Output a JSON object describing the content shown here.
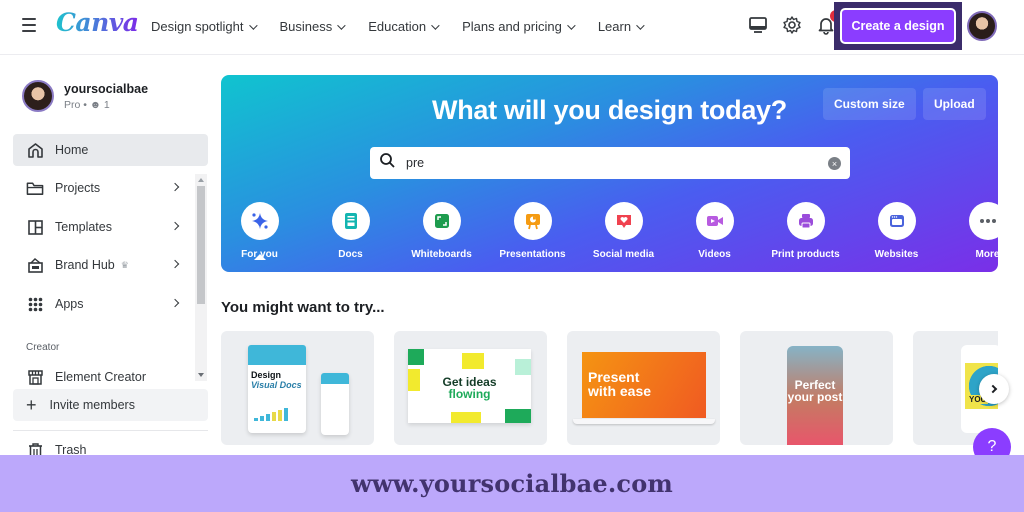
{
  "topbar": {
    "logo": "Canva",
    "nav": [
      {
        "label": "Design spotlight"
      },
      {
        "label": "Business"
      },
      {
        "label": "Education"
      },
      {
        "label": "Plans and pricing"
      },
      {
        "label": "Learn"
      }
    ],
    "icons": [
      "desktop-icon",
      "gear-icon",
      "bell-icon"
    ],
    "notification_count": "1",
    "create_label": "Create a design"
  },
  "sidebar": {
    "user_name": "yoursocialbae",
    "user_plan": "Pro",
    "user_members": "1",
    "items": [
      {
        "label": "Home",
        "icon": "home-icon",
        "active": true
      },
      {
        "label": "Projects",
        "icon": "folder-icon"
      },
      {
        "label": "Templates",
        "icon": "templates-icon"
      },
      {
        "label": "Brand Hub",
        "icon": "brand-icon"
      },
      {
        "label": "Apps",
        "icon": "apps-icon"
      }
    ],
    "heading": "Creator",
    "creator_item": "Element Creator",
    "invite_label": "Invite members",
    "trash_label": "Trash"
  },
  "hero": {
    "title": "What will you design today?",
    "custom_size": "Custom size",
    "upload": "Upload",
    "search_value": "pre",
    "categories": [
      {
        "label": "For you",
        "color": "#3a63e8"
      },
      {
        "label": "Docs",
        "color": "#13b5b1"
      },
      {
        "label": "Whiteboards",
        "color": "#1e9c4e"
      },
      {
        "label": "Presentations",
        "color": "#f59b12"
      },
      {
        "label": "Social media",
        "color": "#f0424f"
      },
      {
        "label": "Videos",
        "color": "#b75be0"
      },
      {
        "label": "Print products",
        "color": "#9b4ddb"
      },
      {
        "label": "Websites",
        "color": "#4a63dc"
      },
      {
        "label": "More",
        "color": "#5b5f66"
      }
    ]
  },
  "suggestions": {
    "title": "You might want to try...",
    "cards": [
      {
        "text_a": "Design",
        "text_b": "Visual Docs"
      },
      {
        "text_a": "Get ideas",
        "text_b": "flowing"
      },
      {
        "text_a": "Present",
        "text_b": "with ease"
      },
      {
        "text_a": "Perfect",
        "text_b": "your post"
      },
      {
        "text_a": "YOU",
        "text_b": ""
      }
    ]
  },
  "help_label": "?",
  "banner": {
    "text": "www.yoursocialbae.com"
  }
}
